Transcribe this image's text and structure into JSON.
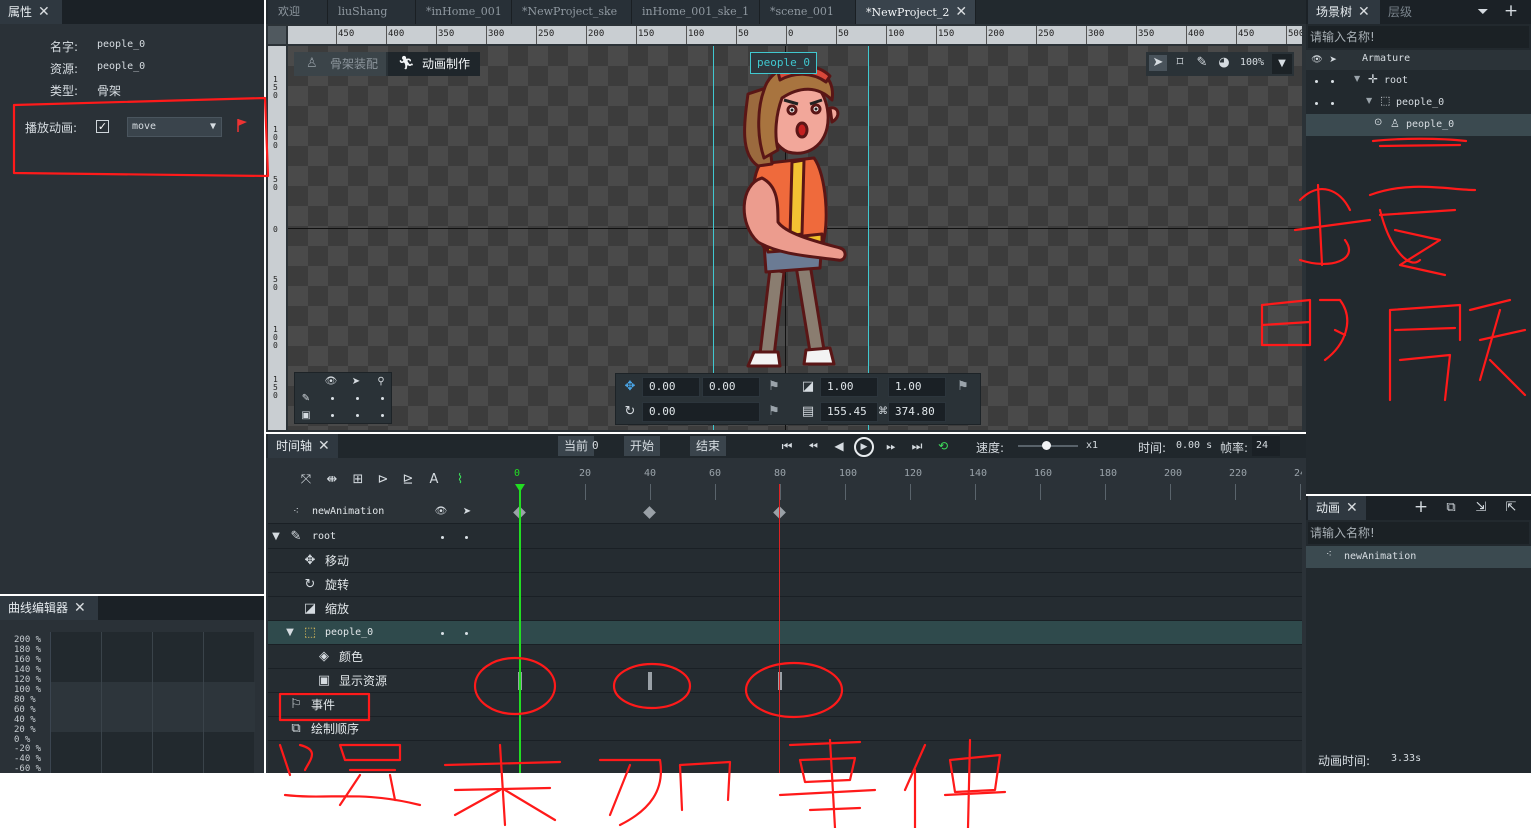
{
  "colors": {
    "accent": "#4a90d9",
    "playhead": "#22dd22",
    "marker": "#dd2222",
    "annotation": "#ff1a1a",
    "guide": "#40c8d0"
  },
  "left_panel": {
    "tab": "属性",
    "name_label": "名字:",
    "name_value": "people_0",
    "resource_label": "资源:",
    "resource_value": "people_0",
    "type_label": "类型:",
    "type_value": "骨架",
    "play_label": "播放动画:",
    "play_select": "move"
  },
  "curve_editor": {
    "tab": "曲线编辑器",
    "ticks": [
      "200 %",
      "180 %",
      "160 %",
      "140 %",
      "120 %",
      "100 %",
      "80 %",
      "60 %",
      "40 %",
      "20 %",
      "0 %",
      "-20 %",
      "-40 %",
      "-60 %"
    ]
  },
  "doc_tabs": [
    "欢迎",
    "liuShang",
    "*inHome_001",
    "*NewProject_ske",
    "inHome_001_ske_1",
    "*scene_001",
    "*NewProject_2"
  ],
  "ruler_top": [
    "450",
    "400",
    "350",
    "300",
    "250",
    "200",
    "150",
    "100",
    "50",
    "0",
    "50",
    "100",
    "150",
    "200",
    "250",
    "300",
    "350",
    "400",
    "450",
    "500"
  ],
  "ruler_left": [
    "150",
    "100",
    "50",
    "0",
    "50",
    "100",
    "150"
  ],
  "viewport": {
    "mode_rig": "骨架装配",
    "mode_anim": "动画制作",
    "armature_label": "people_0",
    "zoom": "100%",
    "transform": {
      "pos_x": "0.00",
      "pos_y": "0.00",
      "rot": "0.00",
      "scale_x": "1.00",
      "scale_y": "1.00",
      "size_w": "155.45",
      "size_h": "374.80"
    }
  },
  "scene_tree": {
    "tab": "场景树",
    "tab2": "层级",
    "search_placeholder": "请输入名称!",
    "items": [
      "Armature",
      "root",
      "people_0",
      "people_0"
    ]
  },
  "anim_panel": {
    "tab": "动画",
    "search_placeholder": "请输入名称!",
    "items": [
      "newAnimation"
    ],
    "duration_label": "动画时间:",
    "duration_value": "3.33s"
  },
  "timeline": {
    "tab": "时间轴",
    "current_label": "当前",
    "current_value": "0",
    "start_label": "开始",
    "end_label": "结束",
    "speed_label": "速度:",
    "speed_value": "x1",
    "time_label": "时间:",
    "time_value": "0.00 s",
    "fps_label": "帧率:",
    "fps_value": "24",
    "frame_ticks": [
      "0",
      "20",
      "40",
      "60",
      "80",
      "100",
      "120",
      "140",
      "160",
      "180",
      "200",
      "220",
      "24"
    ],
    "rows": {
      "anim": "newAnimation",
      "root": "root",
      "move": "移动",
      "rotate": "旋转",
      "scale": "缩放",
      "people": "people_0",
      "color": "颜色",
      "display": "显示资源",
      "event": "事件",
      "draw_order": "绘制顺序"
    }
  },
  "annotation_text": "这是未加事件 / 换套的骨骼"
}
